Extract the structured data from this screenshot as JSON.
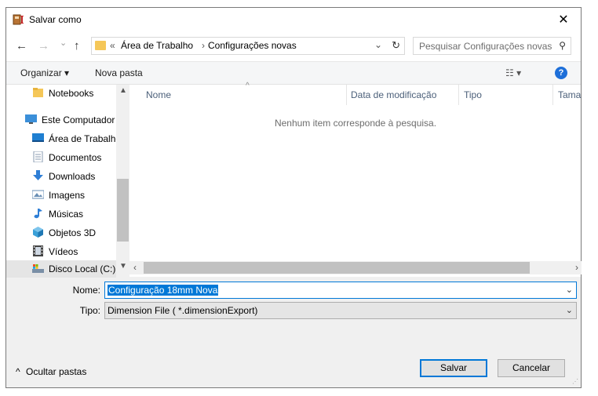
{
  "window": {
    "title": "Salvar como",
    "close_glyph": "✕"
  },
  "nav": {
    "back_glyph": "←",
    "forward_glyph": "→",
    "recent_glyph": "⌄",
    "up_glyph": "↑",
    "address": {
      "prefix": "«",
      "crumbs": [
        "Área de Trabalho",
        "Configurações novas"
      ],
      "separator": "›",
      "dropdown_glyph": "⌄",
      "refresh_glyph": "↻"
    },
    "search": {
      "placeholder": "Pesquisar Configurações novas",
      "icon": "search-icon",
      "glyph": "⚲"
    }
  },
  "toolbar": {
    "organize": "Organizar ▾",
    "new_folder": "Nova pasta",
    "view_glyph": "☷ ▾",
    "help": "?"
  },
  "sidebar": {
    "items": [
      {
        "label": "Notebooks",
        "icon": "folder-icon",
        "level": 1,
        "color": "#f5c758"
      },
      {
        "label": "Este Computador",
        "icon": "computer-icon",
        "level": 0,
        "color": "#3b8fd9"
      },
      {
        "label": "Área de Trabalho",
        "icon": "desktop-icon",
        "level": 1,
        "color": "#1f7fd1"
      },
      {
        "label": "Documentos",
        "icon": "document-icon",
        "level": 1,
        "color": "#8a9bb0"
      },
      {
        "label": "Downloads",
        "icon": "download-icon",
        "level": 1,
        "color": "#2f7fd6"
      },
      {
        "label": "Imagens",
        "icon": "picture-icon",
        "level": 1,
        "color": "#6a8fb5"
      },
      {
        "label": "Músicas",
        "icon": "music-icon",
        "level": 1,
        "color": "#2f7fd6"
      },
      {
        "label": "Objetos 3D",
        "icon": "cube-icon",
        "level": 1,
        "color": "#3aa0d8"
      },
      {
        "label": "Vídeos",
        "icon": "video-icon",
        "level": 1,
        "color": "#444444"
      },
      {
        "label": "Disco Local (C:)",
        "icon": "drive-icon",
        "level": 1,
        "color": "#7a8fa6"
      }
    ]
  },
  "list": {
    "columns": [
      "Nome",
      "Data de modificação",
      "Tipo",
      "Tama"
    ],
    "sort_glyph": "^",
    "empty_message": "Nenhum item corresponde à pesquisa."
  },
  "form": {
    "name_label": "Nome:",
    "name_value": "Configuração 18mm Nova",
    "type_label": "Tipo:",
    "type_value": "Dimension File  ( *.dimensionExport)",
    "chevron": "⌄"
  },
  "footer": {
    "hide_folders": "Ocultar pastas",
    "hide_glyph": "^",
    "save": "Salvar",
    "cancel": "Cancelar"
  },
  "colors": {
    "accent": "#0078d7",
    "help": "#1e6fd9"
  }
}
